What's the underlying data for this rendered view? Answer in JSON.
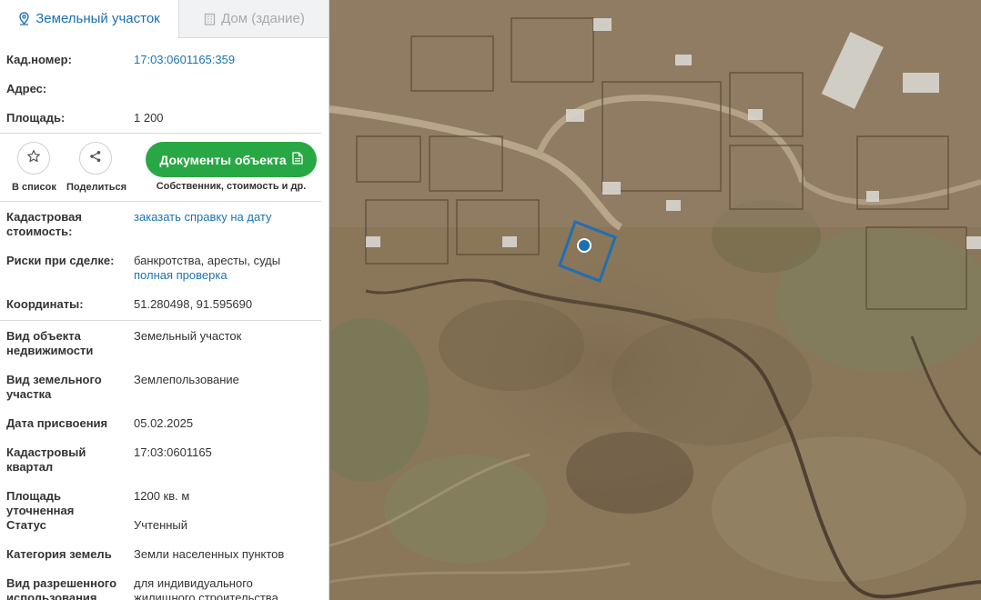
{
  "tabs": {
    "land": "Земельный участок",
    "house": "Дом (здание)"
  },
  "summary": {
    "cad_label": "Кад.номер:",
    "cad_value": "17:03:0601165:359",
    "address_label": "Адрес:",
    "area_label": "Площадь:",
    "area_value": "1 200"
  },
  "actions": {
    "favorite_label": "В список",
    "share_label": "Поделиться",
    "docs_button": "Документы объекта",
    "docs_caption": "Собственник, стоимость и др.",
    "favorite_icon": "star-icon",
    "share_icon": "share-icon",
    "docs_icon": "document-icon"
  },
  "details": {
    "cad_cost_label": "Кадастровая стоимость:",
    "cad_cost_link": "заказать справку на дату",
    "risks_label": "Риски при сделке:",
    "risks_value": "банкротства, аресты, суды",
    "risks_link": "полная проверка",
    "coords_label": "Координаты:",
    "coords_value": "51.280498, 91.595690",
    "object_type_label": "Вид объекта недвижимости",
    "object_type_value": "Земельный участок",
    "land_type_label": "Вид земельного участка",
    "land_type_value": "Землепользование",
    "date_label": "Дата присвоения",
    "date_value": "05.02.2025",
    "quarter_label": "Кадастровый квартал",
    "quarter_value": "17:03:0601165",
    "area_precise_label": "Площадь уточненная",
    "area_precise_value": "1200 кв. м",
    "status_label": "Статус",
    "status_value": "Учтенный",
    "category_label": "Категория земель",
    "category_value": "Земли населенных пунктов",
    "permitted_label": "Вид разрешенного использования",
    "permitted_value": "для индивидуального жилищного строительства"
  },
  "colors": {
    "accent": "#1a6fb0",
    "button_green": "#28a745",
    "parcel_outline": "#1f6fb3"
  }
}
